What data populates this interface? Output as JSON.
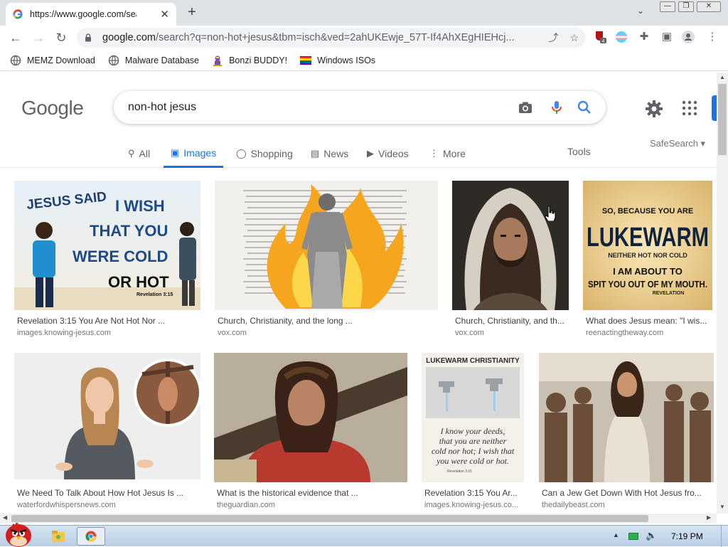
{
  "browser": {
    "tab_title": "https://www.google.com/search?q",
    "tab_close": "✕",
    "new_tab": "+",
    "url_host": "google.com",
    "url_path": "/search?q=non-hot+jesus&tbm=isch&ved=2ahUKEwje_57T-If4AhXEgHIEHcj...",
    "ext_badge": "4"
  },
  "bookmarks": [
    {
      "label": "MEMZ Download",
      "icon": "globe-icon"
    },
    {
      "label": "Malware Database",
      "icon": "globe-icon"
    },
    {
      "label": "Bonzi BUDDY!",
      "icon": "bonzi-icon"
    },
    {
      "label": "Windows ISOs",
      "icon": "rainbow-flag-icon"
    }
  ],
  "google": {
    "logo": "Google",
    "query": "non-hot jesus"
  },
  "tabs": [
    {
      "label": "All",
      "icon": "search-icon"
    },
    {
      "label": "Images",
      "icon": "image-icon",
      "active": true
    },
    {
      "label": "Shopping",
      "icon": "tag-icon"
    },
    {
      "label": "News",
      "icon": "news-icon"
    },
    {
      "label": "Videos",
      "icon": "video-icon"
    },
    {
      "label": "More",
      "icon": "more-icon"
    }
  ],
  "tools_label": "Tools",
  "safesearch_label": "SafeSearch",
  "results": [
    {
      "caption": "Revelation 3:15 You Are Not Hot Nor ...",
      "source": "images.knowing-jesus.com",
      "image_text": [
        "JESUS SAID",
        "I WISH",
        "THAT YOU",
        "WERE COLD",
        "OR HOT",
        "Revelation 3:15"
      ]
    },
    {
      "caption": "Church, Christianity, and the long ...",
      "source": "vox.com",
      "image_text": []
    },
    {
      "caption": "Church, Christianity, and th...",
      "source": "vox.com",
      "image_text": []
    },
    {
      "caption": "What does Jesus mean: \"I wis...",
      "source": "reenactingtheway.com",
      "image_text": [
        "SO, BECAUSE YOU ARE",
        "LUKEWARM",
        "NEITHER HOT NOR COLD",
        "I AM ABOUT TO",
        "SPIT YOU OUT OF MY MOUTH.",
        "REVELATION"
      ]
    },
    {
      "caption": "We Need To Talk About How Hot Jesus Is ...",
      "source": "waterfordwhispersnews.com",
      "image_text": []
    },
    {
      "caption": "What is the historical evidence that ...",
      "source": "theguardian.com",
      "image_text": []
    },
    {
      "caption": "Revelation 3:15 You Ar...",
      "source": "images.knowing-jesus.co...",
      "image_text": [
        "LUKEWARM CHRISTIANITY",
        "I know your deeds,",
        "that you are neither",
        "cold nor hot; I wish that",
        "you were cold or hot.",
        "Revelation 3:15"
      ]
    },
    {
      "caption": "Can a Jew Get Down With Hot Jesus fro...",
      "source": "thedailybeast.com",
      "image_text": []
    }
  ],
  "taskbar": {
    "clock": "7:19 PM"
  }
}
